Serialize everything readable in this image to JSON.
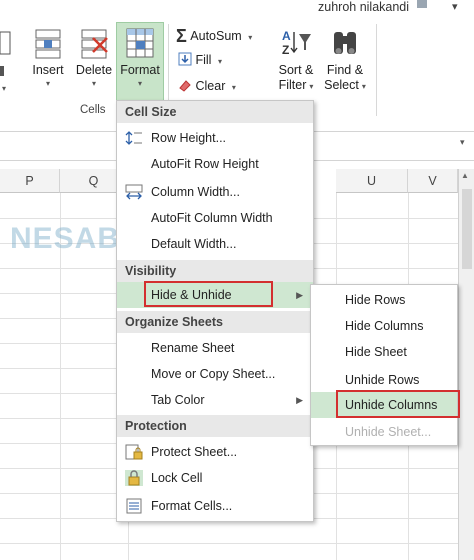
{
  "user": {
    "name": "zuhroh nilakandi"
  },
  "ribbon": {
    "insert_label": "Insert",
    "delete_label": "Delete",
    "format_label": "Format",
    "cells_group_label": "Cells",
    "autosum_label": "AutoSum",
    "fill_label": "Fill",
    "clear_label": "Clear",
    "sort_filter_label_1": "Sort &",
    "sort_filter_label_2": "Filter",
    "find_select_label_1": "Find &",
    "find_select_label_2": "Select"
  },
  "grid": {
    "columns": [
      "P",
      "Q",
      "U",
      "V"
    ]
  },
  "watermark": "NESABAMEDIA",
  "format_menu": {
    "sections": {
      "cell_size": "Cell Size",
      "visibility": "Visibility",
      "organize": "Organize Sheets",
      "protection": "Protection"
    },
    "items": {
      "row_height": "Row Height...",
      "autofit_row": "AutoFit Row Height",
      "column_width": "Column Width...",
      "autofit_column": "AutoFit Column Width",
      "default_width": "Default Width...",
      "hide_unhide": "Hide & Unhide",
      "rename_sheet": "Rename Sheet",
      "move_copy": "Move or Copy Sheet...",
      "tab_color": "Tab Color",
      "protect_sheet": "Protect Sheet...",
      "lock_cell": "Lock Cell",
      "format_cells": "Format Cells..."
    }
  },
  "hide_submenu": {
    "items": [
      "Hide Rows",
      "Hide Columns",
      "Hide Sheet",
      "Unhide Rows",
      "Unhide Columns",
      "Unhide Sheet..."
    ],
    "highlighted": "Unhide Columns",
    "disabled": "Unhide Sheet..."
  },
  "colors": {
    "menu_highlight": "#cfe7d1",
    "callout_red": "#d32f2f",
    "section_bg": "#e8e8e8"
  }
}
